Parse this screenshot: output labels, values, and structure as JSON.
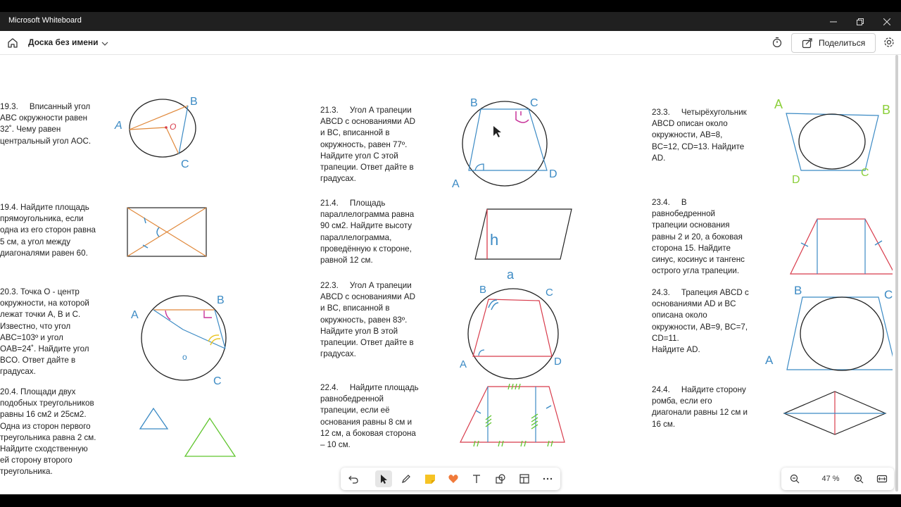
{
  "window": {
    "title": "Microsoft Whiteboard"
  },
  "appbar": {
    "board_title": "Доска без имени",
    "share_label": "Поделиться"
  },
  "zoom": {
    "level": "47 %"
  },
  "colors": {
    "accent": "#3b8ac4",
    "orange": "#e0883a",
    "red": "#d83b4b",
    "green": "#5fc52d",
    "pink": "#c8339a",
    "yellow": "#e9c21a"
  },
  "problems": {
    "p193": "19.3.     Вписанный угол\nABC окружности равен\n32˚. Чему равен\nцентральный угол AOC.",
    "p194": "19.4. Найдите площадь\nпрямоугольника, если\nодна из его сторон равна\n5 см, а угол между\nдиагоналями равен 60.",
    "p203": "20.3. Точка O - центр\nокружности, на которой\nлежат точки A, B и C.\nИзвестно, что угол\nABC=103º и угол\nOAB=24˚. Найдите угол\nBCO. Ответ дайте в\nградусах.",
    "p204": "20.4. Площади двух\nподобных треугольников\nравны 16 см2 и 25см2.\nОдна из сторон первого\nтреугольника равна 2 см.\nНайдите сходственную\nей сторону второго\nтреугольника.",
    "p213": "21.3.     Угол A трапеции\nABCD с основаниями AD\nи BC, вписанной в\nокружность, равен 77º.\nНайдите угол C этой\nтрапеции. Ответ дайте в\nградусах.",
    "p214": "21.4.     Площадь\nпараллелограмма равна\n90 см2. Найдите высоту\nпараллелограмма,\nпроведённую к стороне,\nравной 12 см.",
    "p223": "22.3.     Угол A трапеции\nABCD с основаниями AD\nи BC, вписанной в\nокружность, равен 83º.\nНайдите угол B этой\nтрапеции. Ответ дайте в\nградусах.",
    "p224": "22.4.     Найдите площадь\nравнобедренной\nтрапеции, если её\nоснования равны 8 см и\n12 см, а боковая сторона\n– 10 см.",
    "p233": "23.3.     Четырёхугольник\nABCD описан около\nокружности, AB=8,\nBC=12, CD=13. Найдите\nAD.",
    "p234": "23.4.     В\nравнобедренной\nтрапеции основания\nравны 2 и 20, а боковая\nсторона 15. Найдите\nсинус, косинус и тангенс\nострого угла трапеции.",
    "p243": "24.3.     Трапеция ABCD с\nоснованиями AD и BC\nописана около\nокружности, AB=9, BC=7,\nCD=11.\nНайдите AD.",
    "p244": "24.4.     Найдите сторону\nромба, если его\nдиагонали равны 12 см и\n16 см."
  },
  "labels": {
    "A": "A",
    "B": "B",
    "C": "C",
    "D": "D",
    "O": "O",
    "o": "o",
    "h": "h",
    "a": "a"
  }
}
